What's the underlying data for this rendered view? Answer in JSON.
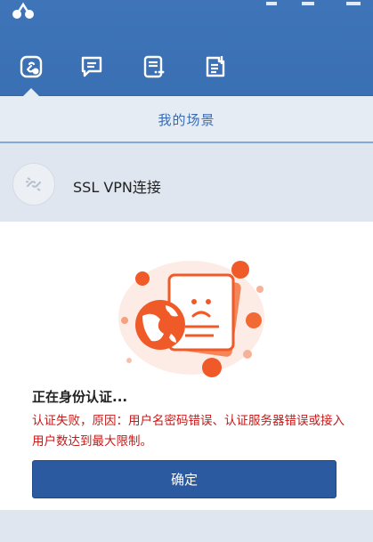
{
  "tabs": [
    {
      "icon": "link-scene-icon",
      "active": true
    },
    {
      "icon": "chat-icon",
      "active": false
    },
    {
      "icon": "list-icon",
      "active": false
    },
    {
      "icon": "document-icon",
      "active": false
    }
  ],
  "scene": {
    "title": "我的场景"
  },
  "vpn": {
    "label": "SSL VPN连接",
    "icon": "broken-link-icon"
  },
  "status": {
    "title": "正在身份认证...",
    "error": "认证失败，原因：用户名密码错误、认证服务器错误或接入用户数达到最大限制。",
    "illustration": "error-document-globe-illustration"
  },
  "actions": {
    "confirm_label": "确定"
  },
  "colors": {
    "header": "#3c72b6",
    "accent": "#3a6bb1",
    "error": "#c51a1a",
    "button": "#2b5aa0",
    "illustration_orange": "#f05a28"
  }
}
